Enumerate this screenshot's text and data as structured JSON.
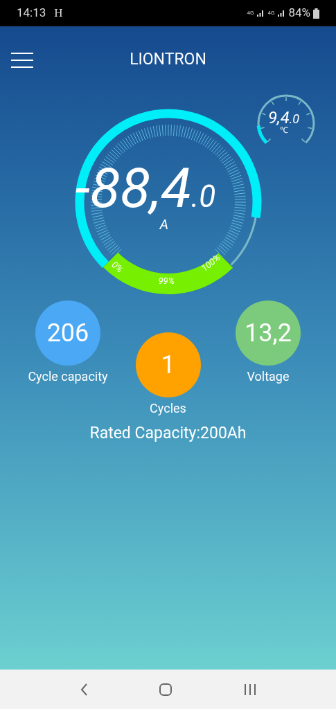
{
  "status_bar": {
    "time": "14:13",
    "carrier": "H",
    "net_1": "4G",
    "net_2": "4G",
    "battery": "84%"
  },
  "header": {
    "title": "LIONTRON"
  },
  "temperature": {
    "value": "9,4",
    "decimal": ".0",
    "unit": "℃"
  },
  "current": {
    "value": "-88,4",
    "decimal": ".0",
    "unit": "A"
  },
  "soc": {
    "min_label": "0%",
    "reading": "99%",
    "max_label": "100%"
  },
  "stats": [
    {
      "value": "206",
      "label": "Cycle capacity",
      "color": "#4aa8f5"
    },
    {
      "value": "1",
      "label": "Cycles",
      "color": "#ffa200"
    },
    {
      "value": "13,2",
      "label": "Voltage",
      "color": "#7ccb7c"
    }
  ],
  "rated_capacity": "Rated Capacity:200Ah"
}
